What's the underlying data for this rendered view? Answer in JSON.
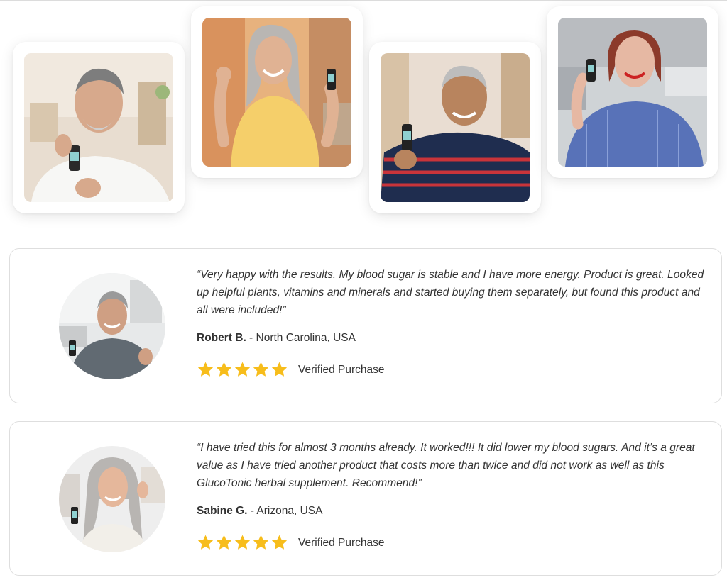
{
  "gallery": {
    "photos": [
      {
        "subject": "man holding dropper bottle"
      },
      {
        "subject": "woman cheering with bottle"
      },
      {
        "subject": "man in striped sweater holding bottle"
      },
      {
        "subject": "woman holding bottle up"
      }
    ]
  },
  "reviews": [
    {
      "quote": "“Very happy with the results. My blood sugar is stable and I have more energy. Product is great. Looked up helpful plants, vitamins and minerals and started buying them separately, but found this product and all were included!”",
      "name": "Robert B.",
      "location": " - North Carolina, USA",
      "rating": 5,
      "badge": "Verified Purchase"
    },
    {
      "quote": "“I have tried this for almost 3 months already. It worked!!! It did lower my blood sugars. And it’s a great value as I have tried another product that costs more than twice and did not work as well as this GlucoTonic herbal supplement. Recommend!”",
      "name": "Sabine G.",
      "location": " - Arizona, USA",
      "rating": 5,
      "badge": "Verified Purchase"
    }
  ],
  "colors": {
    "star": "#f7bd1b",
    "text": "#333333",
    "card_border": "#dedede"
  },
  "icons": {
    "rating": "star-icon"
  }
}
